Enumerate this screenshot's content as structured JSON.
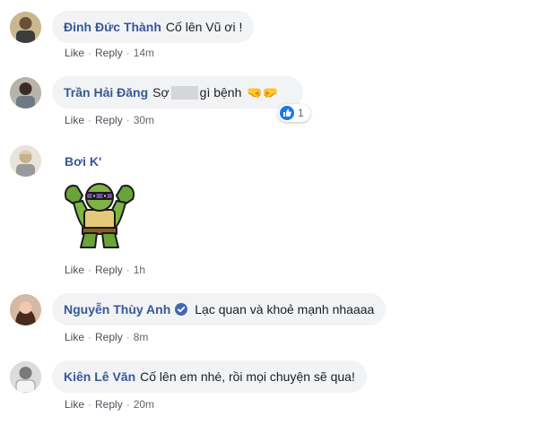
{
  "comments": [
    {
      "author": "Đinh Đức Thành",
      "text": "Cố lên Vũ ơi !",
      "like": "Like",
      "reply": "Reply",
      "time": "14m"
    },
    {
      "author": "Trần Hải Đăng",
      "text_before": "Sợ",
      "text_after": "gì bệnh",
      "emoji": "🤜🤛",
      "reaction_count": "1",
      "like": "Like",
      "reply": "Reply",
      "time": "30m"
    },
    {
      "author": "Bơi K'",
      "sticker": "ninja-turtle-sticker",
      "like": "Like",
      "reply": "Reply",
      "time": "1h"
    },
    {
      "author": "Nguyễn Thùy Anh",
      "text": "Lạc quan và khoẻ mạnh nhaaaa",
      "like": "Like",
      "reply": "Reply",
      "time": "8m"
    },
    {
      "author": "Kiên Lê Văn",
      "text": "Cố lên em nhé, rồi mọi chuyện sẽ qua!",
      "like": "Like",
      "reply": "Reply",
      "time": "20m"
    }
  ],
  "separator": "·",
  "colors": {
    "author": "#385898",
    "bubble": "#f2f3f5",
    "meta": "#616770",
    "like_blue": "#1877f2"
  }
}
